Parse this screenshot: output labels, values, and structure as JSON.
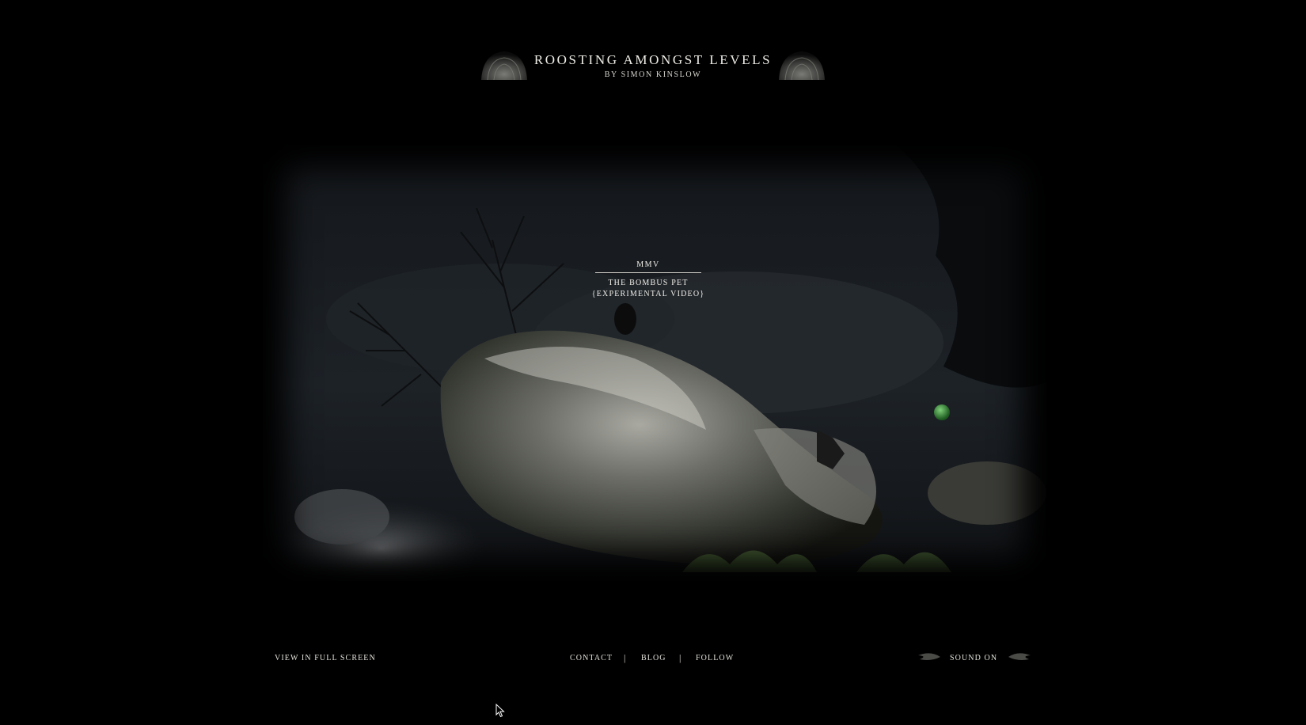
{
  "header": {
    "title": "ROOSTING AMONGST LEVELS",
    "byline": "BY SIMON KINSLOW"
  },
  "project": {
    "year": "MMV",
    "name": "THE BOMBUS PET",
    "subtitle": "{EXPERIMENTAL VIDEO}"
  },
  "footer": {
    "fullscreen": "VIEW IN FULL SCREEN",
    "nav": [
      {
        "label": "CONTACT"
      },
      {
        "label": "BLOG"
      },
      {
        "label": "FOLLOW"
      }
    ],
    "separator": "|",
    "sound": "SOUND ON"
  },
  "icons": {
    "header_ornaments": "shell-ornament-icon",
    "sound_wings": "feather-icon",
    "pointer": "mouse-cursor-icon"
  },
  "colors": {
    "background": "#000000",
    "text": "#e8e6df"
  }
}
